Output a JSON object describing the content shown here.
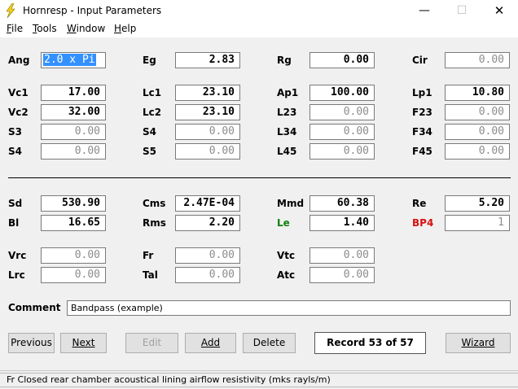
{
  "window": {
    "title": "Hornresp - Input Parameters",
    "min_glyph": "—",
    "max_glyph": "☐",
    "close_glyph": "✕"
  },
  "menu": [
    {
      "key": "F",
      "rest": "ile"
    },
    {
      "key": "T",
      "rest": "ools"
    },
    {
      "key": "W",
      "rest": "indow"
    },
    {
      "key": "H",
      "rest": "elp"
    }
  ],
  "params": {
    "ang": {
      "label": "Ang",
      "value": "2.0 x Pi"
    },
    "eg": {
      "label": "Eg",
      "value": "2.83"
    },
    "rg": {
      "label": "Rg",
      "value": "0.00"
    },
    "cir": {
      "label": "Cir",
      "value": "0.00"
    },
    "vc1": {
      "label": "Vc1",
      "value": "17.00"
    },
    "lc1": {
      "label": "Lc1",
      "value": "23.10"
    },
    "ap1": {
      "label": "Ap1",
      "value": "100.00"
    },
    "lp1": {
      "label": "Lp1",
      "value": "10.80"
    },
    "vc2": {
      "label": "Vc2",
      "value": "32.00"
    },
    "lc2": {
      "label": "Lc2",
      "value": "23.10"
    },
    "l23": {
      "label": "L23",
      "value": "0.00"
    },
    "f23": {
      "label": "F23",
      "value": "0.00"
    },
    "s3": {
      "label": "S3",
      "value": "0.00"
    },
    "s4a": {
      "label": "S4",
      "value": "0.00"
    },
    "l34": {
      "label": "L34",
      "value": "0.00"
    },
    "f34": {
      "label": "F34",
      "value": "0.00"
    },
    "s4b": {
      "label": "S4",
      "value": "0.00"
    },
    "s5": {
      "label": "S5",
      "value": "0.00"
    },
    "l45": {
      "label": "L45",
      "value": "0.00"
    },
    "f45": {
      "label": "F45",
      "value": "0.00"
    },
    "sd": {
      "label": "Sd",
      "value": "530.90"
    },
    "cms": {
      "label": "Cms",
      "value": "2.47E-04"
    },
    "mmd": {
      "label": "Mmd",
      "value": "60.38"
    },
    "re": {
      "label": "Re",
      "value": "5.20"
    },
    "bl": {
      "label": "Bl",
      "value": "16.65"
    },
    "rms": {
      "label": "Rms",
      "value": "2.20"
    },
    "le": {
      "label": "Le",
      "value": "1.40"
    },
    "bp4": {
      "label": "BP4",
      "value": "1"
    },
    "vrc": {
      "label": "Vrc",
      "value": "0.00"
    },
    "fr": {
      "label": "Fr",
      "value": "0.00"
    },
    "vtc": {
      "label": "Vtc",
      "value": "0.00"
    },
    "lrc": {
      "label": "Lrc",
      "value": "0.00"
    },
    "tal": {
      "label": "Tal",
      "value": "0.00"
    },
    "atc": {
      "label": "Atc",
      "value": "0.00"
    }
  },
  "comment": {
    "label": "Comment",
    "value": "Bandpass (example)"
  },
  "buttons": {
    "previous": "Previous",
    "next": "Next",
    "edit": "Edit",
    "add": "Add",
    "delete": "Delete",
    "wizard": "Wizard"
  },
  "record": "Record 53 of 57",
  "status": "Fr   Closed rear chamber acoustical lining airflow resistivity  (mks rayls/m)",
  "colors": {
    "selection": "#3390ff",
    "le_label": "#108010",
    "bp4_label": "#d81010"
  }
}
